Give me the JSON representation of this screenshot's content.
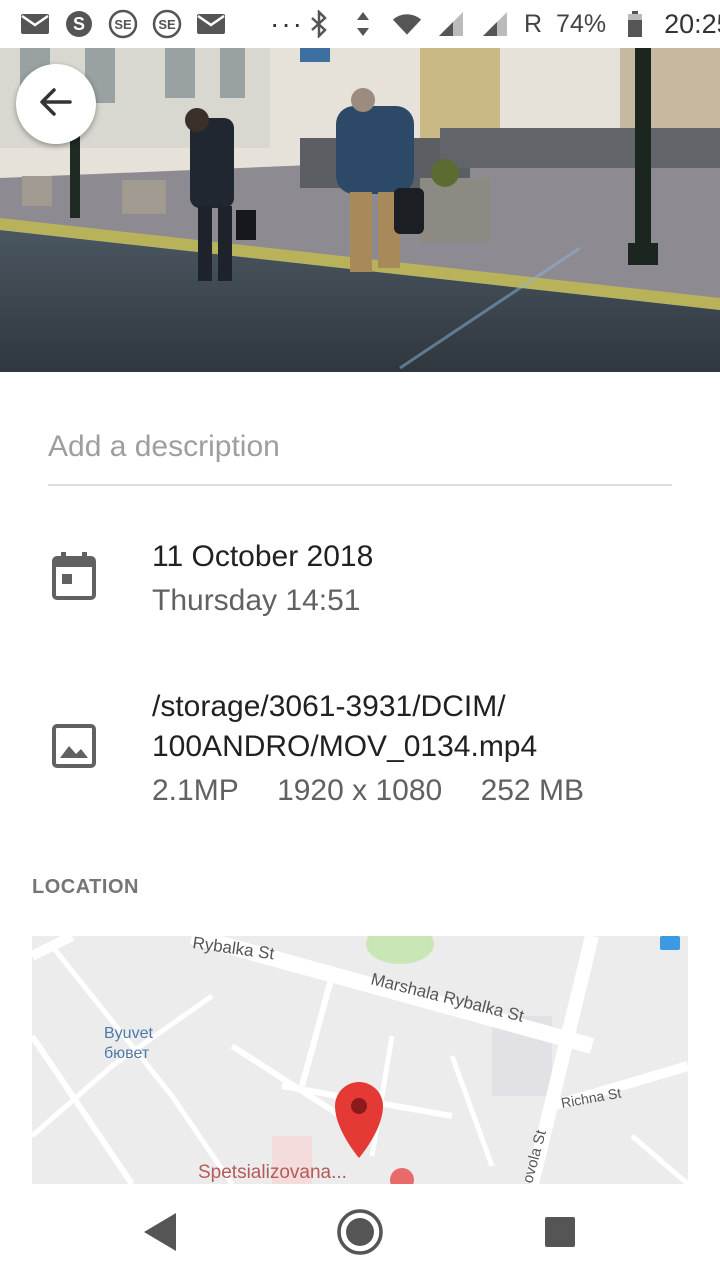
{
  "status_bar": {
    "left_icons": [
      "gmail-icon",
      "skype-icon",
      "se-app-icon",
      "se-app-icon",
      "gmail-icon"
    ],
    "overflow": "···",
    "roaming": "R",
    "battery": "74%",
    "time": "20:25"
  },
  "header": {
    "back_icon": "arrow-back-icon"
  },
  "description": {
    "placeholder": "Add a description",
    "value": ""
  },
  "date_info": {
    "icon": "calendar-icon",
    "date": "11 October 2018",
    "day_time": "Thursday 14:51"
  },
  "file_info": {
    "icon": "image-icon",
    "path_line1": "/storage/3061-3931/DCIM/",
    "path_line2": "100ANDRO/MOV_0134.mp4",
    "megapixels": "2.1MP",
    "resolution": "1920 x 1080",
    "size": "252 MB"
  },
  "location": {
    "label": "LOCATION",
    "map_labels": {
      "street_top": "Rybalka St",
      "street_main": "Marshala Rybalka St",
      "poi_1": "Byuvet",
      "poi_1_local": "бювет",
      "street_right": "Richna St",
      "street_vertical": "ovola St",
      "place": "Spetsializovana..."
    }
  },
  "nav_bar": {
    "back": "nav-back-icon",
    "home": "nav-home-icon",
    "recents": "nav-recents-icon"
  }
}
